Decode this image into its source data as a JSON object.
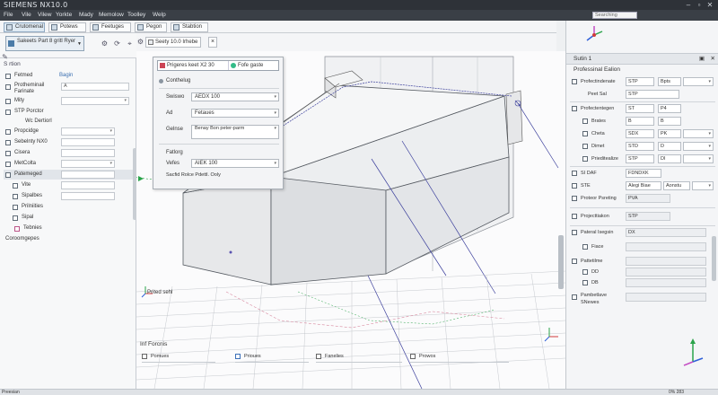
{
  "window": {
    "title": "SIEMENS NX10.0"
  },
  "menu": {
    "items": [
      "File",
      "Vile",
      "Vilew",
      "Yorkte",
      "Mady",
      "Memolow",
      "Toolley",
      "Welp"
    ],
    "search_placeholder": "Searching"
  },
  "ribbon": {
    "tabs": [
      "Crutomenal",
      "Potews",
      "Feetuges",
      "Pegon",
      "Stabtion"
    ]
  },
  "left_panel": {
    "combo_text": "Sakeets Part 8 gritl Ryer",
    "header": "S rtion",
    "rows": [
      {
        "label": "Fetmed",
        "value": "Bagin",
        "arrow": ""
      },
      {
        "label": "Protheminail Farinate",
        "value": "A",
        "arrow": ""
      },
      {
        "label": "Mity",
        "value": "",
        "arrow": "▾"
      },
      {
        "label": "STP Porctor",
        "value": "",
        "arrow": ""
      },
      {
        "label": "Wc Dertiorl",
        "value": "",
        "arrow": ""
      },
      {
        "label": "Propcidge",
        "value": "",
        "arrow": "▾"
      },
      {
        "label": "Sebelnty NX0",
        "value": "",
        "arrow": ""
      },
      {
        "label": "Cisera",
        "value": "",
        "arrow": ""
      },
      {
        "label": "MetColta",
        "value": "",
        "arrow": "▾"
      },
      {
        "label": "Patemeged",
        "value": "",
        "arrow": ""
      },
      {
        "label": "Vite",
        "value": "",
        "arrow": ""
      },
      {
        "label": "Sipalbes",
        "value": "",
        "arrow": ""
      },
      {
        "label": "Prilniities",
        "value": "",
        "arrow": ""
      },
      {
        "label": "Sipal",
        "value": "",
        "arrow": ""
      },
      {
        "label": "Tebnies",
        "value": "",
        "arrow": ""
      },
      {
        "label": "Coroomgepes",
        "value": "",
        "arrow": ""
      }
    ]
  },
  "view_toolbar": {
    "box_label": "Seety 10.0 Irhebe",
    "close_glyph": "×"
  },
  "dialog": {
    "header_left": "Prigeres keet X2 30",
    "header_right": "Fofe gaste",
    "section": "Conthelug",
    "rows": [
      {
        "label": "Swiswo",
        "value": "AEDX 100"
      },
      {
        "label": "Ad",
        "value": "Fetaues"
      },
      {
        "label": "Gelnse",
        "value": "Benay Bon peter-parm"
      }
    ],
    "section2": "Fatlorg",
    "row4": {
      "label": "Vefes",
      "value": "AIEK 100"
    },
    "note": "Sacfid Rolce Pdettl. Ooly"
  },
  "viewport": {
    "status_label": "Prited sehl"
  },
  "bottom": {
    "title": "Inf Forcnis",
    "items": [
      "Pomues",
      "Prioues",
      "Fanelies",
      "Prowos"
    ]
  },
  "right_panel": {
    "header": "Sutin 1",
    "subheader": "Professinal Ealion",
    "rows": [
      {
        "label": "Profectindenate",
        "f1": "STP",
        "f2": "Bpts",
        "f3": ""
      },
      {
        "label": "Peet Sal",
        "f1": "STP",
        "f2": "",
        "f3": ""
      },
      {
        "label": "Profectentegen",
        "f1": "ST",
        "f2": "P4",
        "f3": ""
      },
      {
        "label": "Brates",
        "f1": "B",
        "f2": "B",
        "f3": ""
      },
      {
        "label": "Cheta",
        "f1": "SDX",
        "f2": "PK",
        "f3": ""
      },
      {
        "label": "Dimet",
        "f1": "STD",
        "f2": "D",
        "f3": ""
      },
      {
        "label": "Prieditealize",
        "f1": "STP",
        "f2": "DI",
        "f3": ""
      },
      {
        "label": "SI DAF",
        "f1": "FDNDXK",
        "f2": "",
        "f3": ""
      },
      {
        "label": "STE",
        "f1": "Alegi Biae",
        "f2": "Aonstu",
        "f3": ""
      },
      {
        "label": "Proteor Psreting",
        "f1": "PVA",
        "f2": "",
        "f3": ""
      },
      {
        "label": "Projecttiakon",
        "f1": "STP",
        "f2": "",
        "f3": ""
      },
      {
        "label": "Pateral Isegsin",
        "f1": "DX",
        "f2": "",
        "f3": ""
      },
      {
        "label": "Fiace",
        "f1": "",
        "f2": "",
        "f3": ""
      },
      {
        "label": "Pattetilme",
        "f1": "",
        "f2": "",
        "f3": ""
      },
      {
        "label": "DD",
        "f1": "",
        "f2": "",
        "f3": ""
      },
      {
        "label": "DB",
        "f1": "",
        "f2": "",
        "f3": ""
      },
      {
        "label": "Pambetlave SNewes",
        "f1": "",
        "f2": "",
        "f3": ""
      }
    ]
  },
  "status": {
    "left": "Preesian",
    "right": "0% 283"
  },
  "colors": {
    "axis_x": "#d23b3b",
    "axis_y": "#2aa34a",
    "axis_z": "#2f5fd8",
    "model_line": "#3b3f9c"
  }
}
